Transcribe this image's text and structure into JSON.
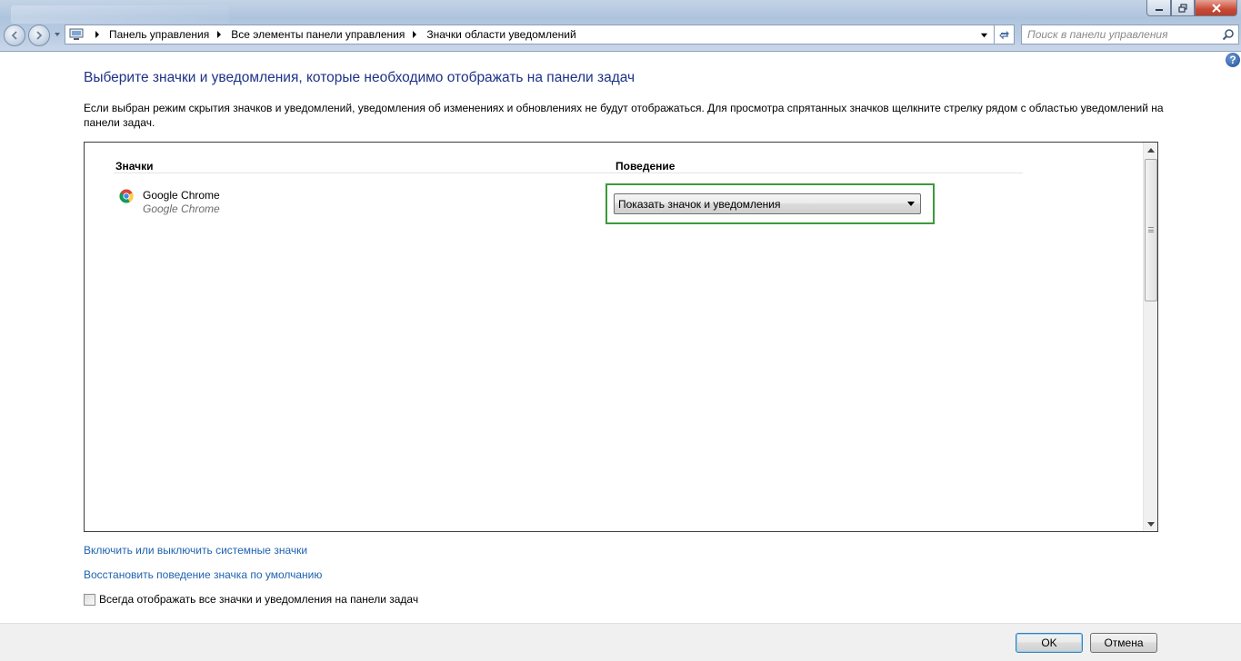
{
  "address_bar": {
    "crumbs": [
      "Панель управления",
      "Все элементы панели управления",
      "Значки области уведомлений"
    ]
  },
  "search": {
    "placeholder": "Поиск в панели управления"
  },
  "help": {
    "symbol": "?"
  },
  "page": {
    "title": "Выберите значки и уведомления, которые необходимо отображать на панели задач",
    "description": "Если выбран режим скрытия значков и уведомлений, уведомления об изменениях и обновлениях не будут отображаться. Для просмотра спрятанных значков щелкните стрелку рядом с областью уведомлений на панели задач."
  },
  "table": {
    "col_icons": "Значки",
    "col_behavior": "Поведение",
    "rows": [
      {
        "name": "Google Chrome",
        "subtitle": "Google Chrome",
        "icon": "chrome-icon",
        "behavior": "Показать значок и уведомления"
      }
    ]
  },
  "links": {
    "system_icons": "Включить или выключить системные значки",
    "restore_default": "Восстановить поведение значка по умолчанию"
  },
  "checkbox": {
    "label": "Всегда отображать все значки и уведомления на панели задач",
    "checked": false
  },
  "buttons": {
    "ok": "OK",
    "cancel": "Отмена"
  },
  "colors": {
    "highlight": "#3c9a3a",
    "title": "#1e3287",
    "link": "#1e62b0"
  }
}
